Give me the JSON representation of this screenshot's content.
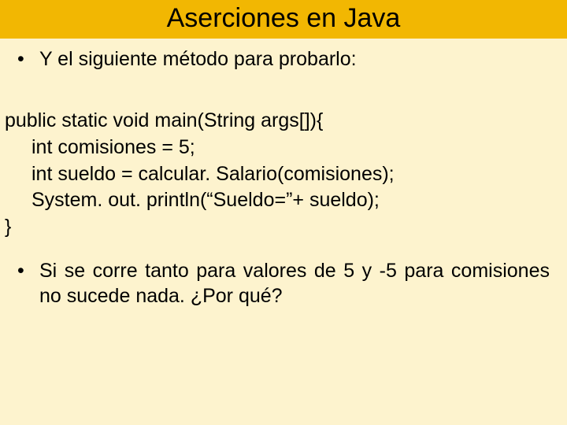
{
  "title": "Aserciones en Java",
  "bullet1": "Y el siguiente método para probarlo:",
  "code": {
    "l1": "public static void main(String args[]){",
    "l2": "int comisiones = 5;",
    "l3": "int sueldo = calcular. Salario(comisiones);",
    "l4": "System. out. println(“Sueldo=”+ sueldo);",
    "l5": "}"
  },
  "bullet2": "Si se corre tanto para valores de 5 y -5 para comisiones no sucede nada. ¿Por qué?",
  "dot": "•"
}
